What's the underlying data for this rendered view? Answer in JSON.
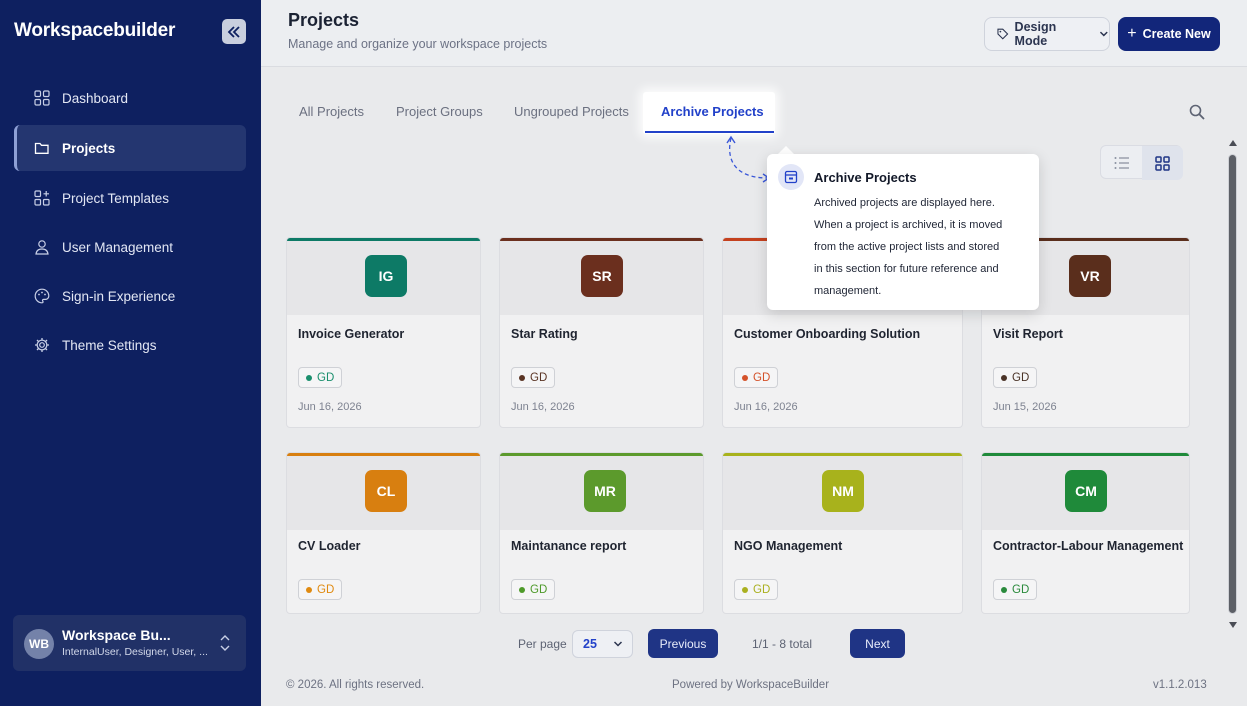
{
  "app": {
    "brand": "Workspacebuilder"
  },
  "sidebar": {
    "items": [
      {
        "label": "Dashboard",
        "icon": "dashboard-icon"
      },
      {
        "label": "Projects",
        "icon": "folder-icon",
        "active": true
      },
      {
        "label": "Project Templates",
        "icon": "templates-icon"
      },
      {
        "label": "User Management",
        "icon": "user-icon"
      },
      {
        "label": "Sign-in Experience",
        "icon": "palette-icon"
      },
      {
        "label": "Theme Settings",
        "icon": "gear-icon"
      }
    ],
    "user": {
      "initials": "WB",
      "name": "Workspace Bu...",
      "roles": "InternalUser, Designer, User, ..."
    }
  },
  "header": {
    "title": "Projects",
    "subtitle": "Manage and organize your workspace projects",
    "mode_label": "Design Mode",
    "create_label": "Create New"
  },
  "tabs": [
    {
      "label": "All Projects"
    },
    {
      "label": "Project Groups"
    },
    {
      "label": "Ungrouped Projects"
    },
    {
      "label": "Archive Projects",
      "active": true
    }
  ],
  "tooltip": {
    "title": "Archive Projects",
    "lines": [
      "Archived projects are displayed here.",
      "When a project is archived, it is moved",
      "from the active project lists and stored",
      "in this section for future reference and",
      "management."
    ]
  },
  "projects": [
    {
      "initials": "IG",
      "name": "Invoice Generator",
      "badge": "GD",
      "date": "Jun 16, 2026",
      "color": "#0d7a66",
      "badge_color": "#1a8f6d"
    },
    {
      "initials": "SR",
      "name": "Star Rating",
      "badge": "GD",
      "date": "Jun 16, 2026",
      "color": "#6b2f1e",
      "badge_color": "#5a3424"
    },
    {
      "initials": "",
      "name": "Customer Onboarding Solution",
      "badge": "GD",
      "date": "Jun 16, 2026",
      "color": "#c4411e",
      "badge_color": "#d4522a"
    },
    {
      "initials": "VR",
      "name": "Visit Report",
      "badge": "GD",
      "date": "Jun 15, 2026",
      "color": "#5a2e1c",
      "badge_color": "#4a3327"
    },
    {
      "initials": "CL",
      "name": "CV Loader",
      "badge": "GD",
      "date": "",
      "color": "#d87f10",
      "badge_color": "#e08a10"
    },
    {
      "initials": "MR",
      "name": "Maintanance report",
      "badge": "GD",
      "date": "",
      "color": "#5c9a2c",
      "badge_color": "#4e9a2a"
    },
    {
      "initials": "NM",
      "name": "NGO Management",
      "badge": "GD",
      "date": "",
      "color": "#a8b21c",
      "badge_color": "#aab020"
    },
    {
      "initials": "CM",
      "name": "Contractor-Labour Management",
      "badge": "GD",
      "date": "",
      "color": "#1f8a3a",
      "badge_color": "#2a8a3c"
    }
  ],
  "pagination": {
    "per_page_label": "Per page",
    "per_page_value": "25",
    "prev_label": "Previous",
    "info": "1/1 - 8 total",
    "next_label": "Next"
  },
  "footer": {
    "copyright": "© 2026. All rights reserved.",
    "powered": "Powered by WorkspaceBuilder",
    "version": "v1.1.2.013"
  }
}
